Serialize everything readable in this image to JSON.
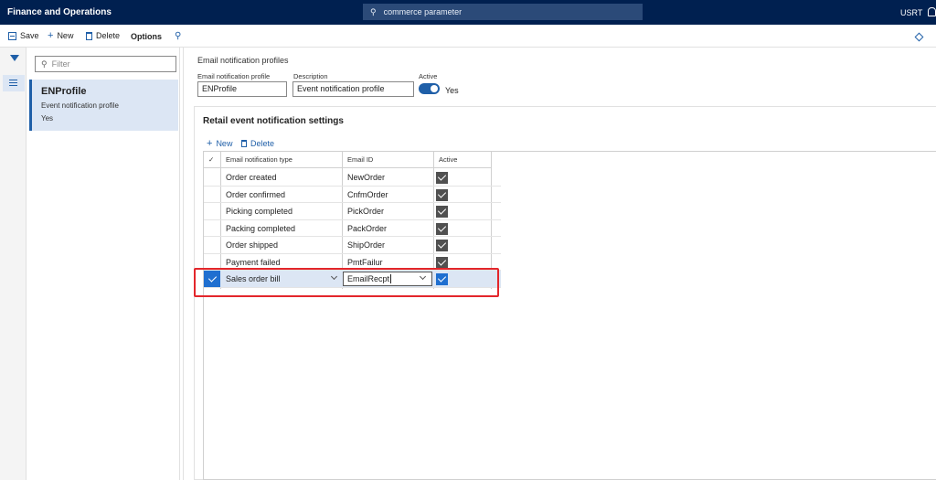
{
  "app": {
    "title": "Finance and Operations",
    "search_value": "commerce parameter",
    "user": "USRT"
  },
  "toolbar": {
    "save_label": "Save",
    "new_label": "New",
    "delete_label": "Delete",
    "options_label": "Options"
  },
  "list": {
    "filter_placeholder": "Filter",
    "items": [
      {
        "title": "ENProfile",
        "description": "Event notification profile",
        "active": "Yes"
      }
    ]
  },
  "header": {
    "caption": "Email notification profiles",
    "profile_label": "Email notification profile",
    "profile_value": "ENProfile",
    "description_label": "Description",
    "description_value": "Event notification profile",
    "active_label": "Active",
    "active_value": "Yes"
  },
  "retail": {
    "title": "Retail event notification settings",
    "new_label": "New",
    "delete_label": "Delete",
    "columns": {
      "type": "Email notification type",
      "email_id": "Email ID",
      "active": "Active"
    },
    "rows": [
      {
        "type": "Order created",
        "email_id": "NewOrder",
        "active": true
      },
      {
        "type": "Order confirmed",
        "email_id": "CnfmOrder",
        "active": true
      },
      {
        "type": "Picking completed",
        "email_id": "PickOrder",
        "active": true
      },
      {
        "type": "Packing completed",
        "email_id": "PackOrder",
        "active": true
      },
      {
        "type": "Order shipped",
        "email_id": "ShipOrder",
        "active": true
      },
      {
        "type": "Payment failed",
        "email_id": "PmtFailur",
        "active": true
      }
    ],
    "selected_row": {
      "type": "Sales order bill",
      "email_id": "EmailRecpt",
      "active": true
    }
  },
  "colors": {
    "nav": "#002050",
    "accent": "#1f5fa8",
    "highlight": "#e3262b"
  },
  "icons": [
    "search-icon",
    "save-icon",
    "plus-icon",
    "trash-icon",
    "filter-icon",
    "list-icon",
    "chevron-down-icon",
    "checkbox-icon",
    "bell-icon",
    "diamond-icon"
  ]
}
